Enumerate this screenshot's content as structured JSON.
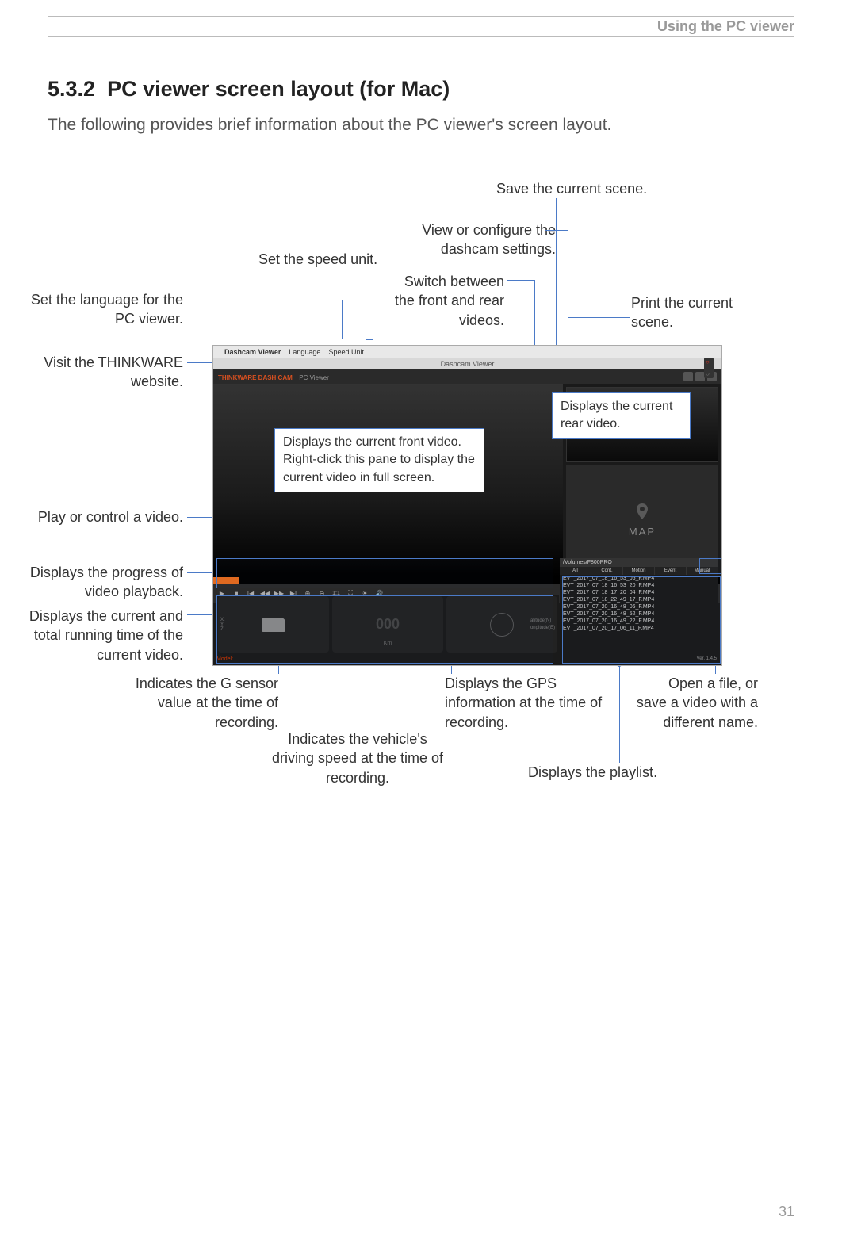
{
  "header": {
    "breadcrumb": "Using the PC viewer"
  },
  "section": {
    "number": "5.3.2",
    "title": "PC viewer screen layout (for Mac)",
    "description": "The following provides brief information about the PC viewer's screen layout."
  },
  "callouts": {
    "save_scene": "Save the current scene.",
    "configure": "View or configure the dashcam settings.",
    "speed_unit": "Set the speed unit.",
    "switch_video": "Switch between the front and rear videos.",
    "language": "Set the language for the PC viewer.",
    "print": "Print the current scene.",
    "website": "Visit the THINKWARE website.",
    "rear_video": "Displays the current rear video.",
    "front_video": "Displays the current front video. Right-click this pane to display the current video in full screen.",
    "play_control": "Play or control a video.",
    "progress": "Displays the progress of video playback.",
    "runtime": "Displays the current and total running time of the current video.",
    "gsensor": "Indicates the G sensor value at the time of recording.",
    "speed": "Indicates the vehicle's driving speed at the time of recording.",
    "gps": "Displays the GPS information at the time of recording.",
    "playlist": "Displays the playlist.",
    "open_file": "Open a file, or save a video with a different name."
  },
  "app": {
    "menubar_title": "Dashcam Viewer",
    "menu_language": "Language",
    "menu_speed": "Speed Unit",
    "titlebar": "Dashcam Viewer",
    "brand": "THINKWARE DASH CAM",
    "subbrand": "PC Viewer",
    "map_label": "MAP",
    "speed_num": "000",
    "speed_unit": "Km",
    "lat_label": "latitude(N)",
    "lng_label": "longitude(E)",
    "playlist_path": "/Volumes/F800PRO",
    "tabs": [
      "All",
      "Cont.",
      "Motion",
      "Event",
      "Manual"
    ],
    "files": [
      "EVT_2017_07_18_16_53_05_F.MP4",
      "EVT_2017_07_18_16_53_20_F.MP4",
      "EVT_2017_07_18_17_20_04_F.MP4",
      "EVT_2017_07_18_22_49_17_F.MP4",
      "EVT_2017_07_20_16_48_06_F.MP4",
      "EVT_2017_07_20_16_48_52_F.MP4",
      "EVT_2017_07_20_16_49_22_F.MP4",
      "EVT_2017_07_20_17_06_11_F.MP4"
    ],
    "version": "Ver. 1.4.5"
  },
  "page_number": "31"
}
